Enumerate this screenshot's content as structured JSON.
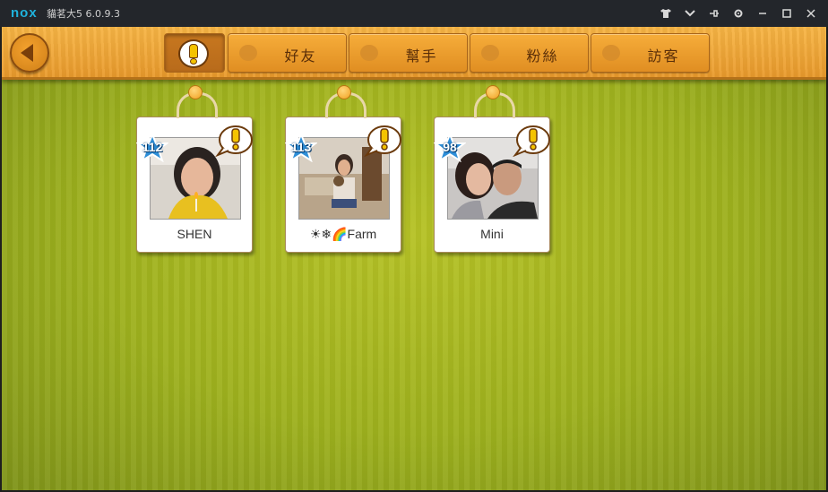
{
  "window": {
    "logo": "nox",
    "title": "貓茗大5 6.0.9.3",
    "controls": [
      "shirt-icon",
      "chevron-down-icon",
      "pin-icon",
      "gear-icon",
      "minimize-icon",
      "maximize-icon",
      "close-icon"
    ]
  },
  "tabs": [
    {
      "id": "alerts",
      "label": "",
      "icon": "exclamation-icon",
      "active": true
    },
    {
      "id": "friends",
      "label": "好友",
      "icon": "bear-icon",
      "active": false
    },
    {
      "id": "helpers",
      "label": "幫手",
      "icon": "heart-icon",
      "active": false
    },
    {
      "id": "fans",
      "label": "粉絲",
      "icon": "star-icon",
      "active": false
    },
    {
      "id": "visitors",
      "label": "訪客",
      "icon": "flag-icon",
      "active": false
    }
  ],
  "cards": [
    {
      "name": "SHEN",
      "level": "112",
      "alert": true
    },
    {
      "name": "☀❄🌈Farm",
      "level": "113",
      "alert": true
    },
    {
      "name": "Mini",
      "level": "98",
      "alert": true
    }
  ],
  "colors": {
    "accent": "#e99a2c",
    "background": "#9eb11e",
    "level_badge": "#2f8fd8",
    "alert": "#f4c300"
  }
}
